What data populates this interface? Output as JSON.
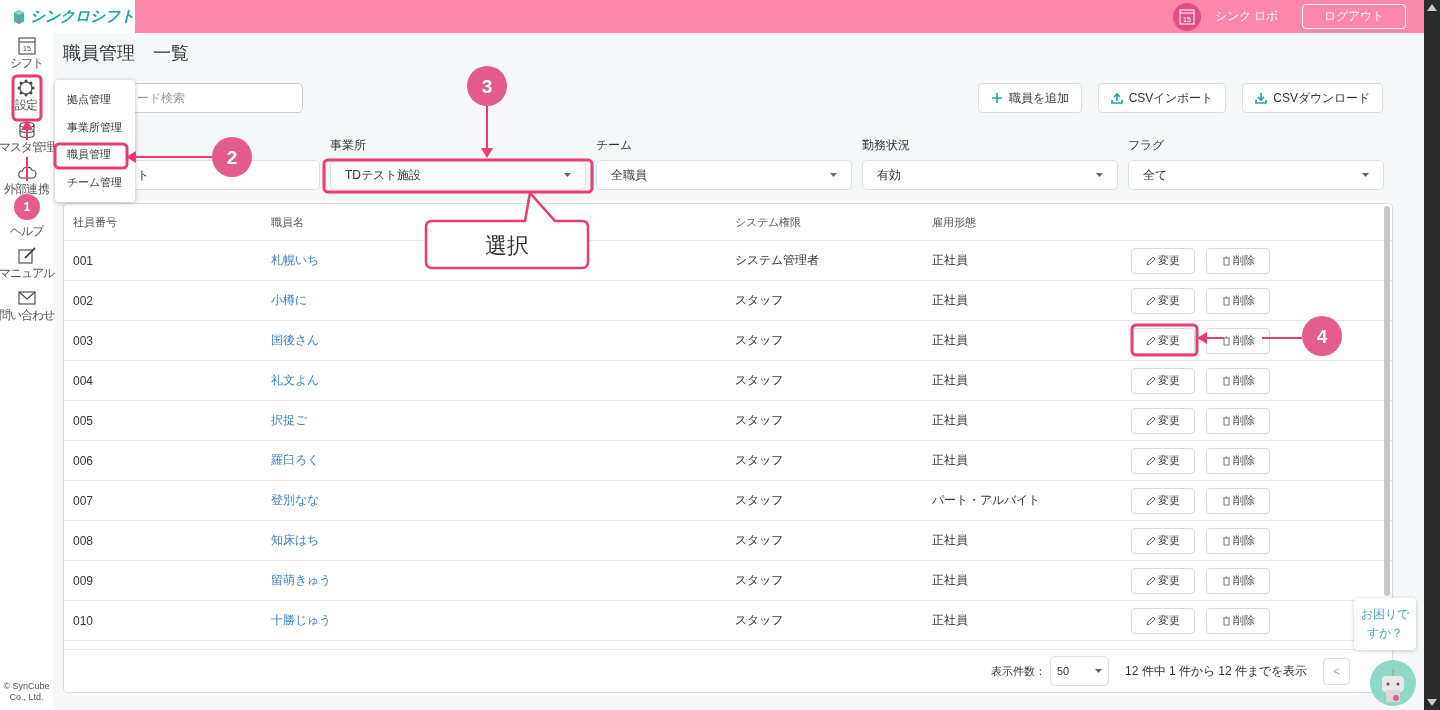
{
  "header": {
    "logo": "シンクロシフト",
    "calendar_day": "15",
    "user": "シンク ロボ",
    "logout": "ログアウト"
  },
  "sidebar": {
    "items": [
      {
        "label": "シフト",
        "day": "15"
      },
      {
        "label": "設定"
      },
      {
        "label": "マスタ管理"
      },
      {
        "label": "外部連携"
      },
      {
        "label": "ヘルプ"
      },
      {
        "label": "マニュアル"
      },
      {
        "label": "問い合わせ"
      }
    ],
    "copyright": "© SynCube Co., Ltd."
  },
  "page_title": "職員管理　一覧",
  "search": {
    "placeholder": "ード検索"
  },
  "actions": [
    {
      "label": "職員を追加"
    },
    {
      "label": "CSVインポート"
    },
    {
      "label": "CSVダウンロード"
    }
  ],
  "filters": [
    {
      "kind": "text",
      "value": "ト"
    },
    {
      "kind": "select",
      "label": "事業所",
      "value": "TDテスト施設"
    },
    {
      "kind": "select",
      "label": "チーム",
      "value": "全職員"
    },
    {
      "kind": "select",
      "label": "勤務状況",
      "value": "有効"
    },
    {
      "kind": "select",
      "label": "フラグ",
      "value": "全て"
    }
  ],
  "settings_menu": {
    "items": [
      "拠点管理",
      "事業所管理",
      "職員管理",
      "チーム管理"
    ]
  },
  "table": {
    "columns": [
      "社員番号",
      "職員名",
      "システム権限",
      "雇用形態"
    ],
    "rows": [
      {
        "id": "001",
        "name": "札幌いち",
        "role": "システム管理者",
        "employment": "正社員",
        "edit": "変更",
        "delete": "削除"
      },
      {
        "id": "002",
        "name": "小樽に",
        "role": "スタッフ",
        "employment": "正社員",
        "edit": "変更",
        "delete": "削除"
      },
      {
        "id": "003",
        "name": "国後さん",
        "role": "スタッフ",
        "employment": "正社員",
        "edit": "変更",
        "delete": "削除"
      },
      {
        "id": "004",
        "name": "礼文よん",
        "role": "スタッフ",
        "employment": "正社員",
        "edit": "変更",
        "delete": "削除"
      },
      {
        "id": "005",
        "name": "択捉ご",
        "role": "スタッフ",
        "employment": "正社員",
        "edit": "変更",
        "delete": "削除"
      },
      {
        "id": "006",
        "name": "羅臼ろく",
        "role": "スタッフ",
        "employment": "正社員",
        "edit": "変更",
        "delete": "削除"
      },
      {
        "id": "007",
        "name": "登別なな",
        "role": "スタッフ",
        "employment": "パート・アルバイト",
        "edit": "変更",
        "delete": "削除"
      },
      {
        "id": "008",
        "name": "知床はち",
        "role": "スタッフ",
        "employment": "正社員",
        "edit": "変更",
        "delete": "削除"
      },
      {
        "id": "009",
        "name": "留萌きゅう",
        "role": "スタッフ",
        "employment": "正社員",
        "edit": "変更",
        "delete": "削除"
      },
      {
        "id": "010",
        "name": "十勝じゅう",
        "role": "スタッフ",
        "employment": "正社員",
        "edit": "変更",
        "delete": "削除"
      }
    ]
  },
  "pagination": {
    "page_size_label": "表示件数：",
    "page_size": "50",
    "summary": "12 件中 1 件から 12 件までを表示",
    "prev": "<"
  },
  "help_chat": {
    "message": "お困りですか？"
  },
  "annotations": {
    "steps": [
      "1",
      "2",
      "3",
      "4"
    ],
    "callout": "選択"
  }
}
